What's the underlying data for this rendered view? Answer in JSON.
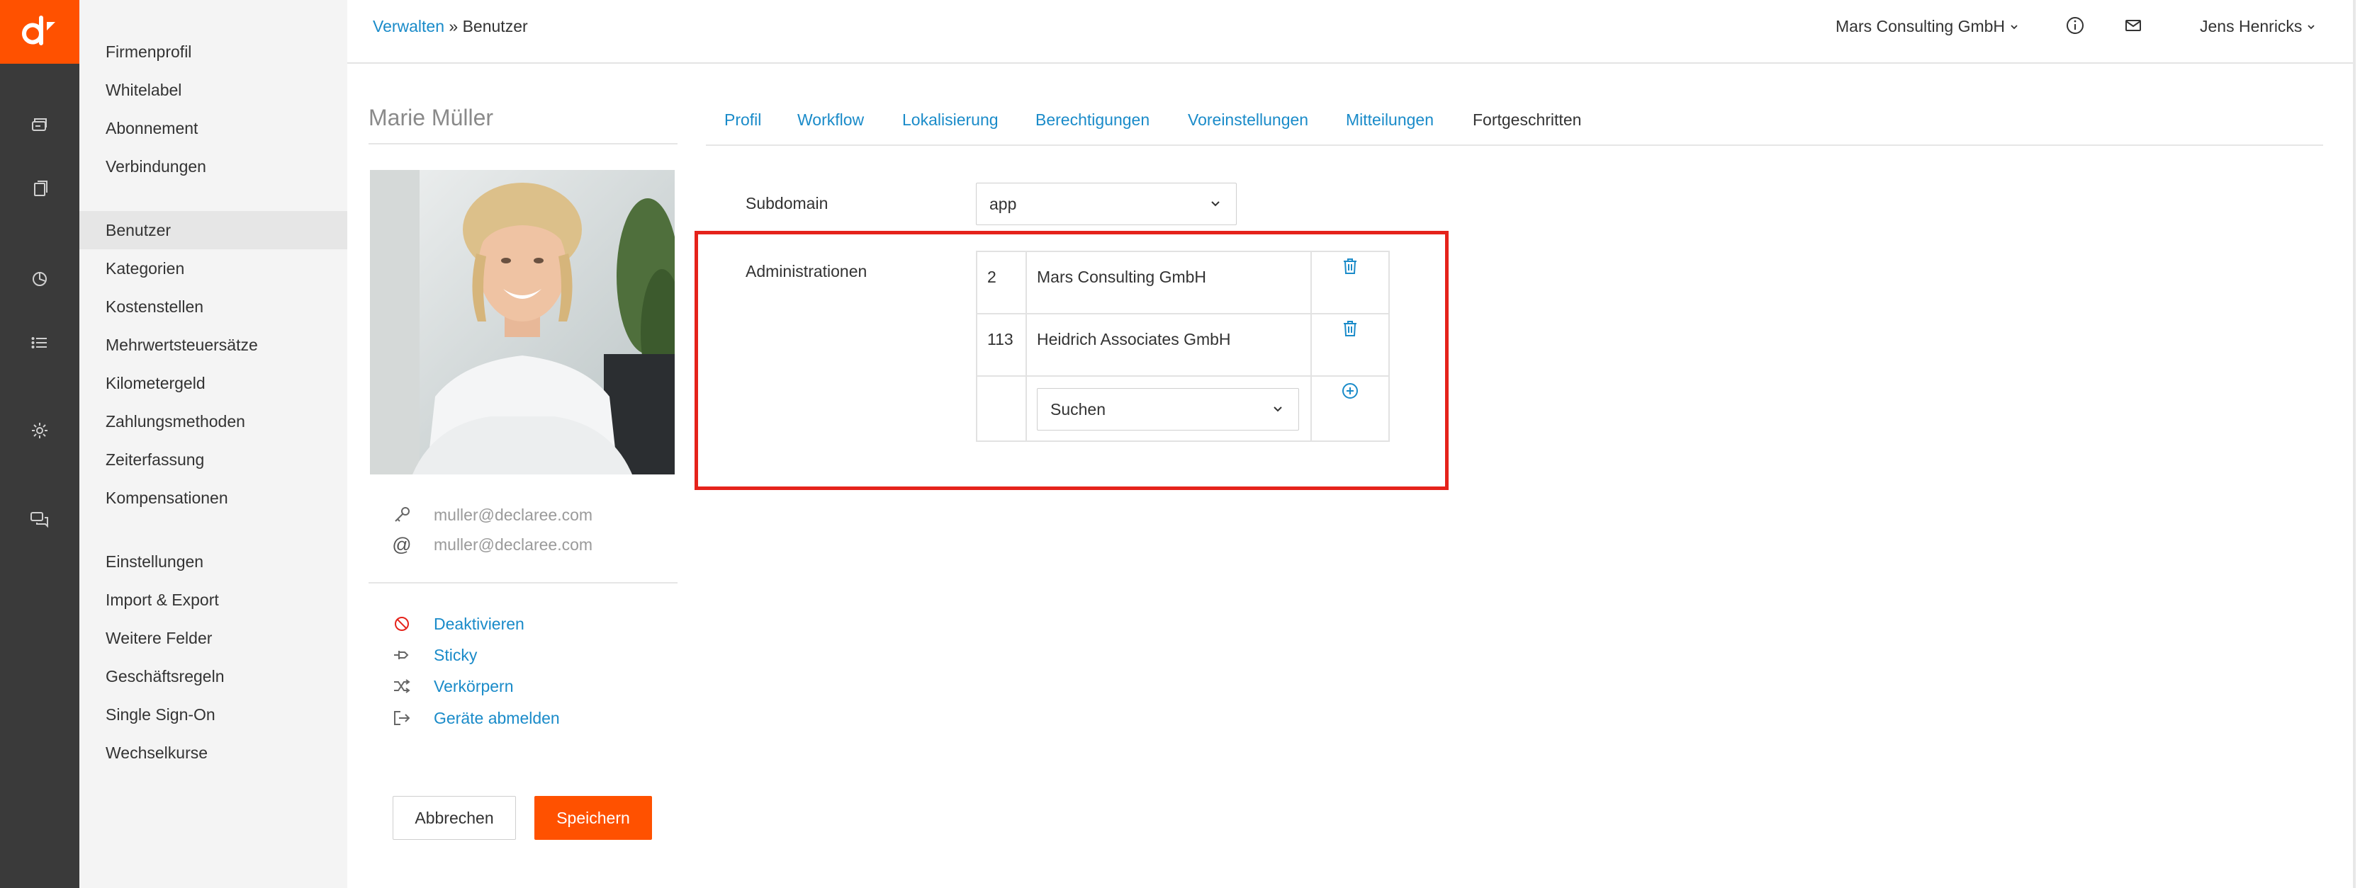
{
  "app": {
    "logo_letter": "d",
    "brand_color": "#ff5100",
    "link_color": "#1a8bc9",
    "rail_color": "#3a3a3a"
  },
  "rail": {
    "icons": [
      "wallet-icon",
      "documents-icon",
      "reports-icon",
      "list-icon",
      "settings-icon",
      "chat-icon"
    ]
  },
  "sidebar": {
    "groups": [
      [
        "Firmenprofil",
        "Whitelabel",
        "Abonnement",
        "Verbindungen"
      ],
      [
        "Benutzer",
        "Kategorien",
        "Kostenstellen",
        "Mehrwertsteuersätze",
        "Kilometergeld",
        "Zahlungsmethoden",
        "Zeiterfassung",
        "Kompensationen"
      ],
      [
        "Einstellungen",
        "Import & Export",
        "Weitere Felder",
        "Geschäftsregeln",
        "Single Sign-On",
        "Wechselkurse"
      ]
    ],
    "active": "Benutzer"
  },
  "header": {
    "breadcrumb_link": "Verwalten",
    "breadcrumb_separator": "»",
    "breadcrumb_current": "Benutzer",
    "company": "Mars Consulting GmbH",
    "user": "Jens Henricks"
  },
  "profile": {
    "name": "Marie Müller",
    "login": "muller@declaree.com",
    "email": "muller@declaree.com",
    "actions": [
      {
        "label": "Deaktivieren",
        "icon": "block-icon"
      },
      {
        "label": "Sticky",
        "icon": "pin-icon"
      },
      {
        "label": "Verkörpern",
        "icon": "shuffle-icon"
      },
      {
        "label": "Geräte abmelden",
        "icon": "logout-icon"
      }
    ]
  },
  "tabs": [
    "Profil",
    "Workflow",
    "Lokalisierung",
    "Berechtigungen",
    "Voreinstellungen",
    "Mitteilungen",
    "Fortgeschritten"
  ],
  "active_tab": "Fortgeschritten",
  "form": {
    "subdomain_label": "Subdomain",
    "subdomain_value": "app",
    "administrations_label": "Administrationen",
    "administrations": [
      {
        "id": "2",
        "name": "Mars Consulting GmbH"
      },
      {
        "id": "113",
        "name": "Heidrich Associates GmbH"
      }
    ],
    "search_placeholder": "Suchen"
  },
  "buttons": {
    "cancel": "Abbrechen",
    "save": "Speichern"
  }
}
